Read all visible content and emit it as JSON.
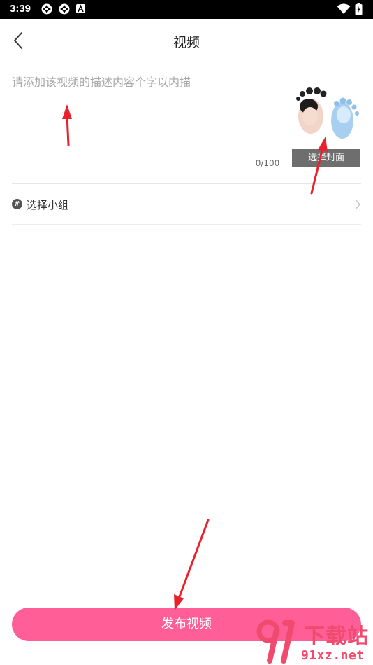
{
  "status_bar": {
    "time": "3:39",
    "icons": [
      "app-notification-icon",
      "app-notification-icon",
      "app-a-icon",
      "wifi-icon",
      "battery-icon"
    ]
  },
  "header": {
    "title": "视频",
    "back_icon": "chevron-left-icon"
  },
  "description": {
    "placeholder": "请添加该视频的描述内容个字以内描",
    "counter": "0/100"
  },
  "cover": {
    "button_label": "选择封面"
  },
  "group": {
    "label": "选择小组",
    "icon": "hash-icon"
  },
  "publish": {
    "label": "发布视频"
  },
  "watermark": {
    "brand": "下载站",
    "url": "91xz.net"
  },
  "colors": {
    "accent": "#ff5e97",
    "annotation_arrow": "#e8212a",
    "watermark": "#f04a6e"
  }
}
